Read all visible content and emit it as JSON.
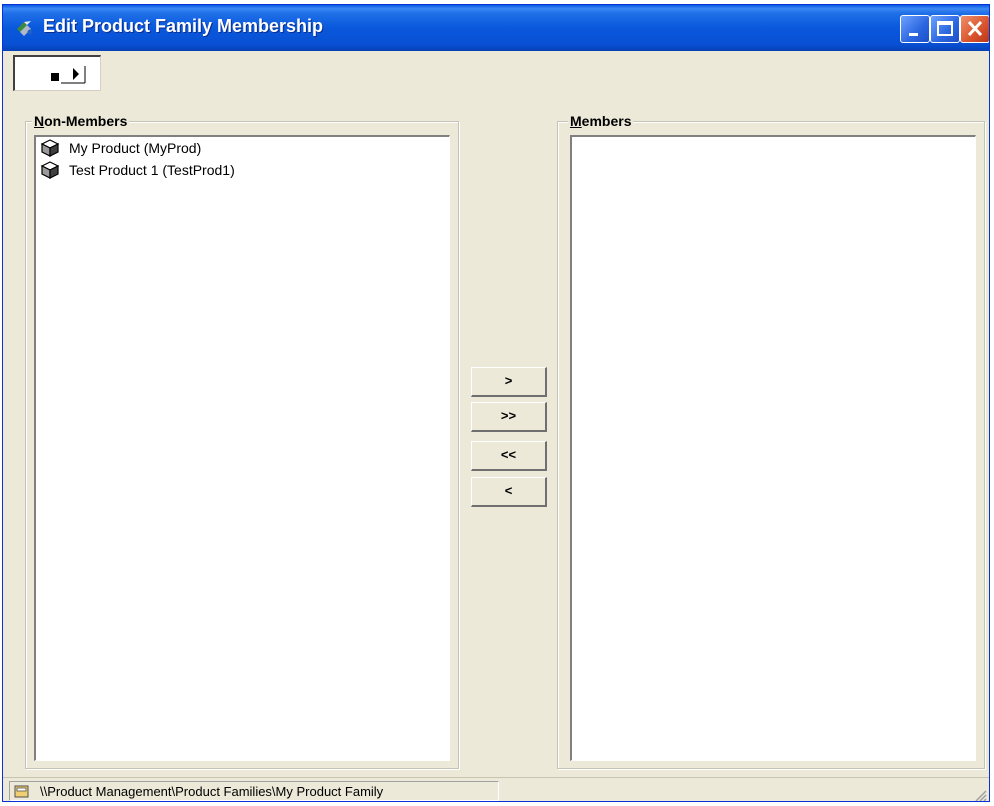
{
  "window": {
    "title": "Edit Product Family Membership",
    "controls": {
      "minimize": "minimize-icon",
      "maximize": "maximize-icon",
      "close": "close-icon"
    }
  },
  "toolbar": {
    "icon": "play-stop-icon"
  },
  "non_members": {
    "label_prefix": "N",
    "label_rest": "on-Members",
    "items": [
      {
        "label": "My Product (MyProd)",
        "icon": "product-box-icon"
      },
      {
        "label": "Test Product 1 (TestProd1)",
        "icon": "product-box-icon"
      }
    ]
  },
  "members": {
    "label_prefix": "M",
    "label_rest": "embers",
    "items": []
  },
  "transfer_buttons": {
    "add_one": ">",
    "add_all": ">>",
    "remove_all": "<<",
    "remove_one": "<"
  },
  "status": {
    "path": "\\\\Product Management\\Product Families\\My Product Family",
    "icon": "folder-icon"
  },
  "colors": {
    "title_bar": "#0a58dc",
    "window_face": "#ece9d8",
    "list_bg": "#ffffff"
  }
}
